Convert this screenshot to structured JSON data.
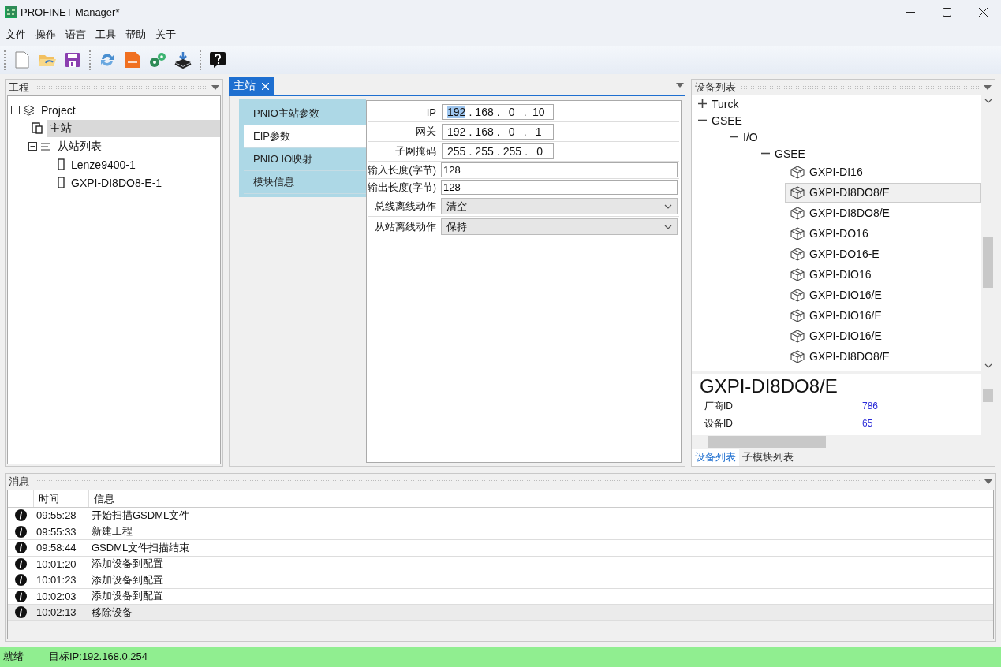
{
  "window": {
    "title": "PROFINET Manager*"
  },
  "menu": [
    "文件",
    "操作",
    "语言",
    "工具",
    "帮助",
    "关于"
  ],
  "project_panel": {
    "title": "工程",
    "tree": [
      {
        "label": "Project",
        "kind": "project",
        "expanded": true,
        "selected": false,
        "children": [
          {
            "label": "主站",
            "kind": "master",
            "selected": true
          },
          {
            "label": "从站列表",
            "kind": "list",
            "expanded": true,
            "selected": false,
            "children": [
              {
                "label": "Lenze9400-1",
                "kind": "device",
                "selected": false
              },
              {
                "label": "GXPI-DI8DO8-E-1",
                "kind": "device",
                "selected": false
              }
            ]
          }
        ]
      }
    ]
  },
  "editor": {
    "tabs": [
      {
        "label": "主站",
        "selected": true
      }
    ],
    "side_tabs": [
      {
        "label": "PNIO主站参数",
        "selected": false
      },
      {
        "label": "EIP参数",
        "selected": true
      },
      {
        "label": "PNIO IO映射",
        "selected": false
      },
      {
        "label": "模块信息",
        "selected": false
      }
    ],
    "fields": [
      {
        "label": "IP",
        "kind": "ip",
        "separator": ".",
        "octets": [
          {
            "text": "192",
            "selected": true
          },
          {
            "text": "168",
            "selected": false
          },
          {
            "text": "0",
            "selected": false
          },
          {
            "text": "10",
            "selected": false
          }
        ]
      },
      {
        "label": "网关",
        "kind": "ip",
        "separator": ".",
        "octets": [
          {
            "text": "192",
            "selected": false
          },
          {
            "text": "168",
            "selected": false
          },
          {
            "text": "0",
            "selected": false
          },
          {
            "text": "1",
            "selected": false
          }
        ]
      },
      {
        "label": "子网掩码",
        "kind": "ip",
        "separator": ".",
        "octets": [
          {
            "text": "255",
            "selected": false
          },
          {
            "text": "255",
            "selected": false
          },
          {
            "text": "255",
            "selected": false
          },
          {
            "text": "0",
            "selected": false
          }
        ]
      },
      {
        "label": "输入长度(字节)",
        "kind": "text",
        "value": "128"
      },
      {
        "label": "输出长度(字节)",
        "kind": "text",
        "value": "128"
      },
      {
        "label": "总线离线动作",
        "kind": "select",
        "value": "清空"
      },
      {
        "label": "从站离线动作",
        "kind": "select",
        "value": "保持"
      }
    ]
  },
  "device_panel": {
    "title": "设备列表",
    "tree": [
      {
        "label": "Turck",
        "expanded": false,
        "selected": false
      },
      {
        "label": "GSEE",
        "expanded": true,
        "selected": false,
        "children": [
          {
            "label": "I/O",
            "expanded": true,
            "selected": false,
            "children": [
              {
                "label": "GSEE",
                "expanded": true,
                "selected": false,
                "children": [
                  {
                    "label": "GXPI-DI16",
                    "kind": "device",
                    "selected": false
                  },
                  {
                    "label": "GXPI-DI8DO8/E",
                    "kind": "device",
                    "selected": true
                  },
                  {
                    "label": "GXPI-DI8DO8/E",
                    "kind": "device",
                    "selected": false
                  },
                  {
                    "label": "GXPI-DO16",
                    "kind": "device",
                    "selected": false
                  },
                  {
                    "label": "GXPI-DO16-E",
                    "kind": "device",
                    "selected": false
                  },
                  {
                    "label": "GXPI-DIO16",
                    "kind": "device",
                    "selected": false
                  },
                  {
                    "label": "GXPI-DIO16/E",
                    "kind": "device",
                    "selected": false
                  },
                  {
                    "label": "GXPI-DIO16/E",
                    "kind": "device",
                    "selected": false
                  },
                  {
                    "label": "GXPI-DIO16/E",
                    "kind": "device",
                    "selected": false
                  },
                  {
                    "label": "GXPI-DI8DO8/E",
                    "kind": "device",
                    "selected": false
                  }
                ]
              }
            ]
          }
        ]
      }
    ],
    "detail": {
      "title": "GXPI-DI8DO8/E",
      "rows": [
        {
          "label": "厂商ID",
          "value": "786"
        },
        {
          "label": "设备ID",
          "value": "65"
        }
      ]
    },
    "tabs": [
      {
        "label": "设备列表",
        "selected": true
      },
      {
        "label": "子模块列表",
        "selected": false
      }
    ]
  },
  "messages": {
    "title": "消息",
    "columns": [
      "时间",
      "信息"
    ],
    "rows": [
      {
        "time": "09:55:28",
        "text": "开始扫描GSDML文件",
        "selected": false
      },
      {
        "time": "09:55:33",
        "text": "新建工程",
        "selected": false
      },
      {
        "time": "09:58:44",
        "text": "GSDML文件扫描结束",
        "selected": false
      },
      {
        "time": "10:01:20",
        "text": "添加设备到配置",
        "selected": false
      },
      {
        "time": "10:01:23",
        "text": "添加设备到配置",
        "selected": false
      },
      {
        "time": "10:02:03",
        "text": "添加设备到配置",
        "selected": false
      },
      {
        "time": "10:02:13",
        "text": "移除设备",
        "selected": true
      }
    ]
  },
  "status_bar": [
    "就绪",
    "目标IP:192.168.0.254"
  ]
}
